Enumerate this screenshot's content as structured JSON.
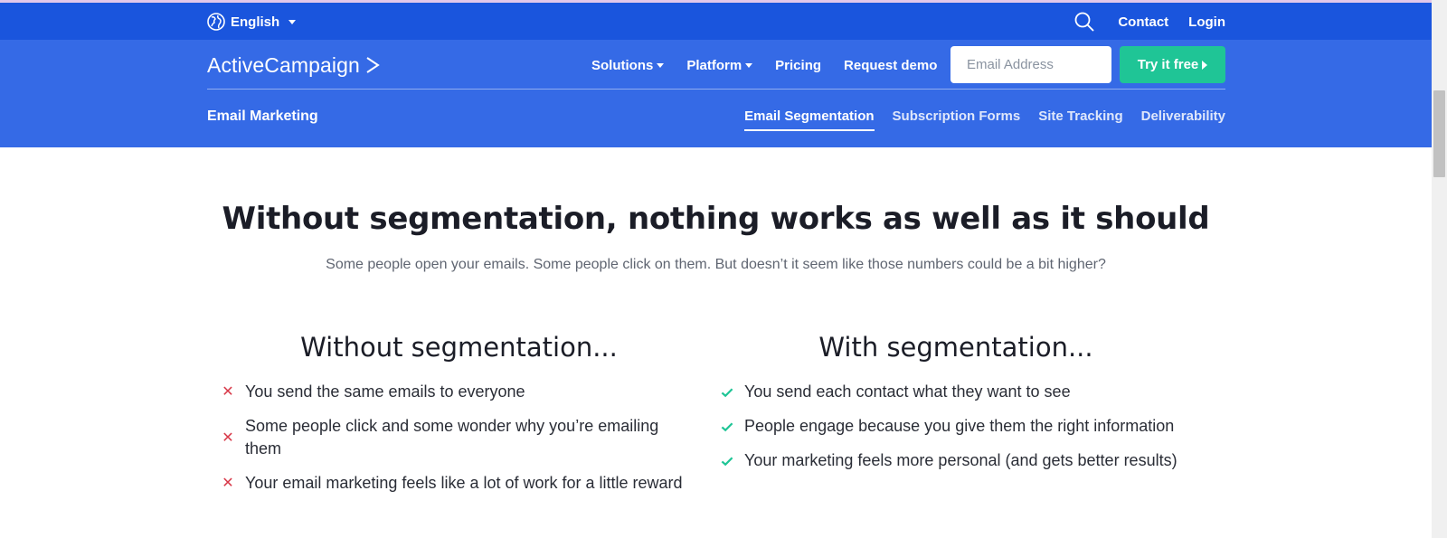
{
  "util": {
    "language": "English",
    "contact": "Contact",
    "login": "Login"
  },
  "nav": {
    "logo_text": "ActiveCampaign",
    "items": [
      {
        "label": "Solutions",
        "dropdown": true
      },
      {
        "label": "Platform",
        "dropdown": true
      },
      {
        "label": "Pricing",
        "dropdown": false
      },
      {
        "label": "Request demo",
        "dropdown": false
      }
    ],
    "email_placeholder": "Email Address",
    "cta_label": "Try it free"
  },
  "subnav": {
    "section_title": "Email Marketing",
    "tabs": [
      {
        "label": "Email Segmentation",
        "active": true
      },
      {
        "label": "Subscription Forms",
        "active": false
      },
      {
        "label": "Site Tracking",
        "active": false
      },
      {
        "label": "Deliverability",
        "active": false
      }
    ]
  },
  "content": {
    "headline": "Without segmentation, nothing works as well as it should",
    "subheadline": "Some people open your emails. Some people click on them. But doesn’t it seem like those numbers could be a bit higher?",
    "without": {
      "title": "Without segmentation...",
      "items": [
        "You send the same emails to everyone",
        "Some people click and some wonder why you’re emailing them",
        "Your email marketing feels like a lot of work for a little reward"
      ]
    },
    "with": {
      "title": "With segmentation...",
      "items": [
        "You send each contact what they want to see",
        "People engage because you give them the right information",
        "Your marketing feels more personal (and gets better results)"
      ]
    }
  },
  "colors": {
    "util_bar": "#1a55dd",
    "nav_bar": "#356ae6",
    "cta": "#1fc596",
    "x_mark": "#d83a4a",
    "check_mark": "#1fc596"
  },
  "icons": {
    "language": "globe-icon",
    "search": "search-icon",
    "logo": "chevron-right-icon",
    "negative": "x-icon",
    "positive": "check-icon"
  }
}
